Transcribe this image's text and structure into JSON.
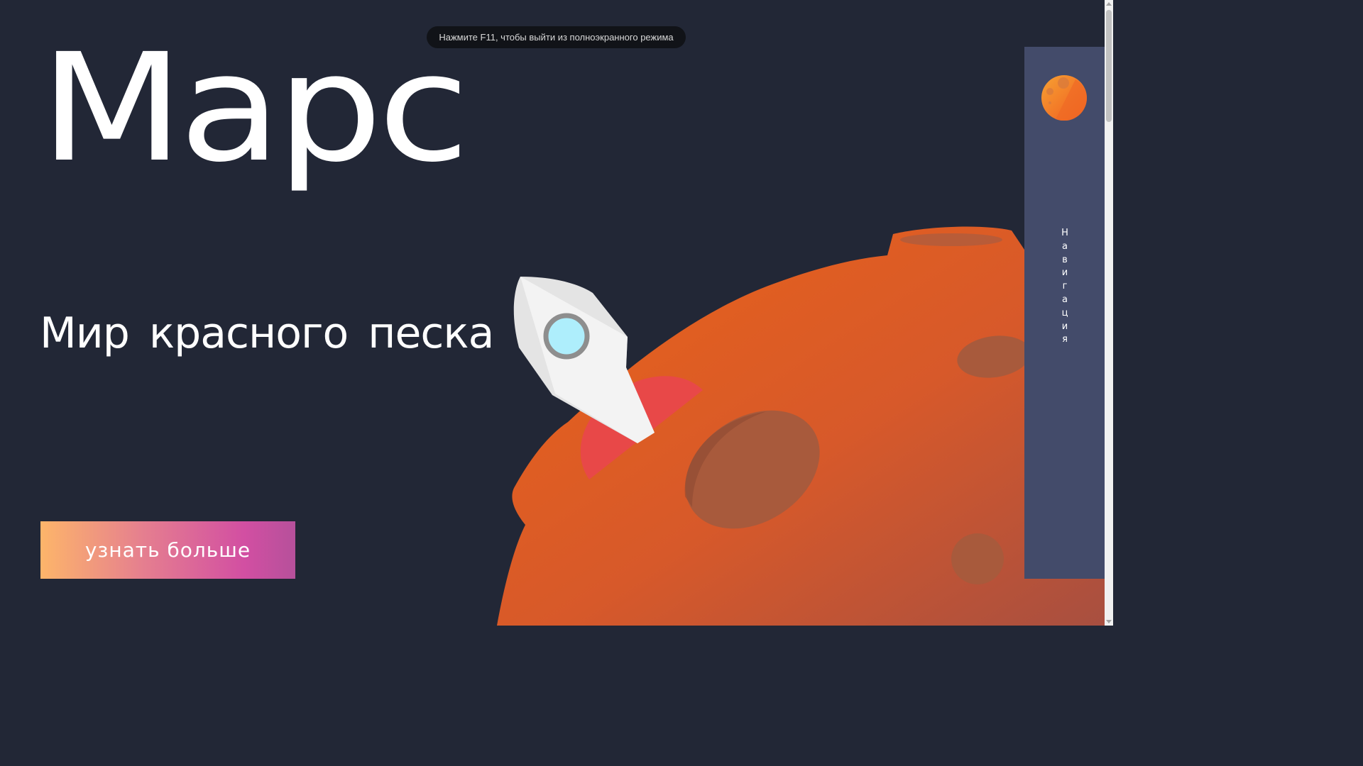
{
  "hero": {
    "title": "Марс",
    "subtitle": "Мир красного песка",
    "cta_label": "узнать больше"
  },
  "fullscreen_notice": "Нажмите F11, чтобы выйти из полноэкранного режима",
  "side_nav": {
    "label_letters": [
      "Н",
      "а",
      "в",
      "и",
      "г",
      "а",
      "ц",
      "и",
      "я"
    ],
    "logo_icon": "mars-planet-icon"
  },
  "illustration": {
    "planet_icon": "mars-planet",
    "rocket_icon": "rocket-icon"
  },
  "colors": {
    "background": "#222736",
    "nav_panel": "#434b6a",
    "planet_orange": "#e2601f",
    "crater": "#a85a3c",
    "rocket_red": "#e84848",
    "rocket_window": "#aeeefc",
    "cta_gradient_start": "#fdb56a",
    "cta_gradient_end": "#b6509b"
  }
}
